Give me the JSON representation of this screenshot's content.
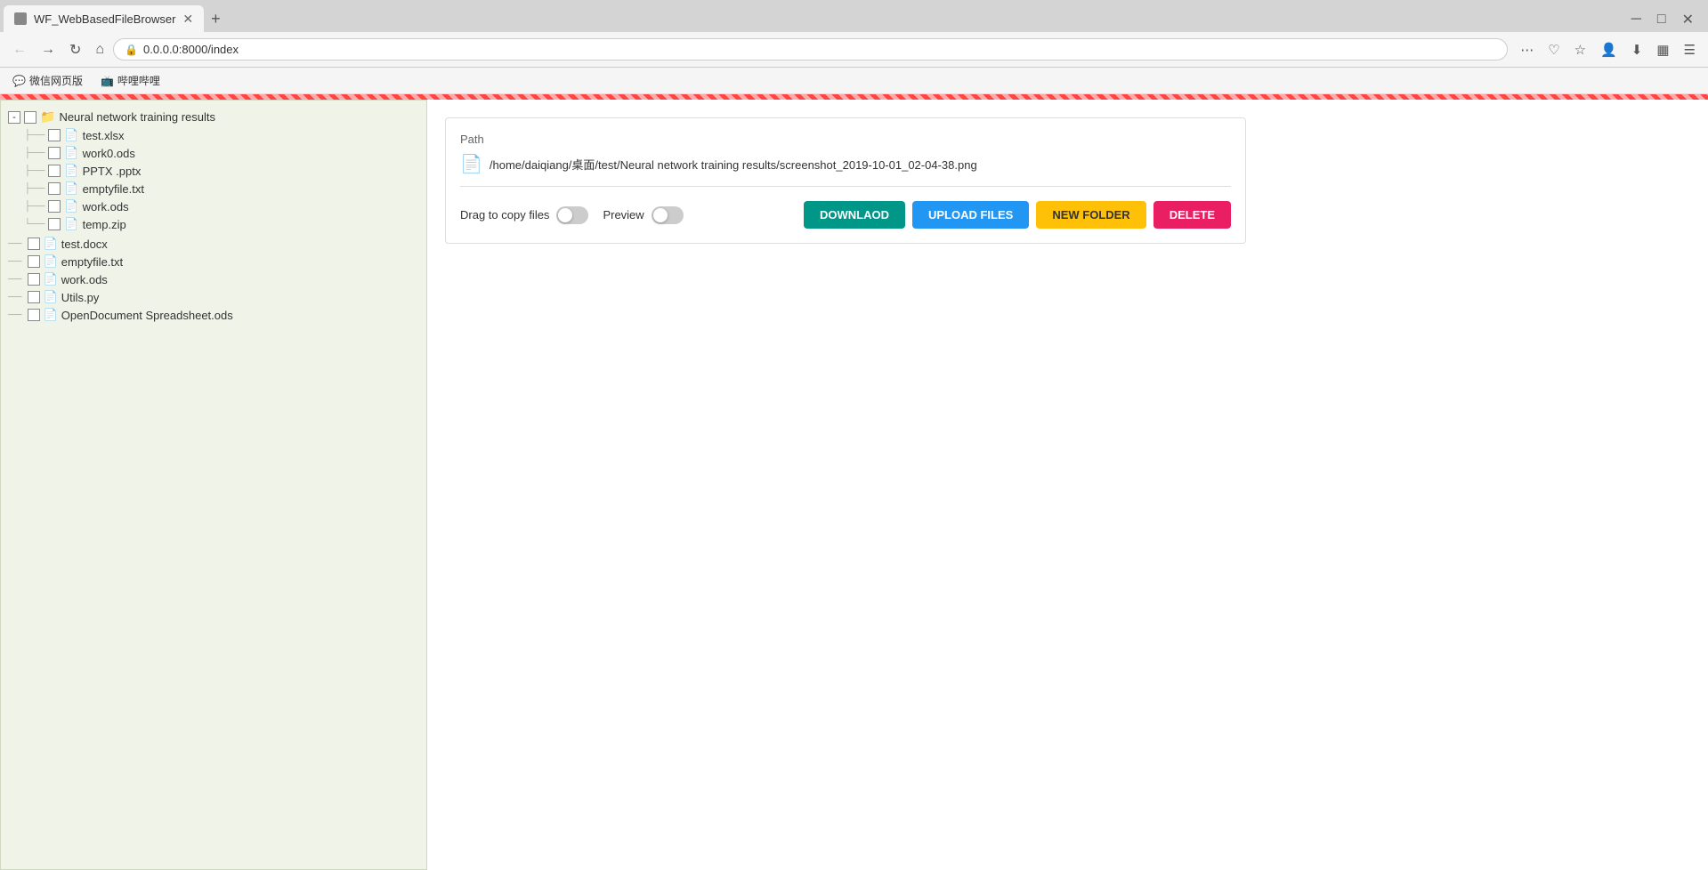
{
  "browser": {
    "tab_title": "WF_WebBasedFileBrowser",
    "address": "0.0.0.0:8000/index",
    "bookmarks": [
      {
        "id": "wechat",
        "label": "微信网页版",
        "icon": "💬"
      },
      {
        "id": "bilibili",
        "label": "哔哩哔哩",
        "icon": "📺"
      }
    ]
  },
  "file_tree": {
    "root": {
      "name": "Neural network training results",
      "children": [
        {
          "name": "test.xlsx",
          "type": "file",
          "indent": 1
        },
        {
          "name": "work0.ods",
          "type": "file",
          "indent": 1
        },
        {
          "name": "PPTX .pptx",
          "type": "file",
          "indent": 1
        },
        {
          "name": "emptyfile.txt",
          "type": "file",
          "indent": 1
        },
        {
          "name": "work.ods",
          "type": "file",
          "indent": 1
        },
        {
          "name": "temp.zip",
          "type": "file",
          "indent": 1
        }
      ]
    },
    "other_items": [
      {
        "name": "test.docx",
        "type": "file",
        "indent": 0
      },
      {
        "name": "emptyfile.txt",
        "type": "file",
        "indent": 0
      },
      {
        "name": "work.ods",
        "type": "file",
        "indent": 0
      },
      {
        "name": "Utils.py",
        "type": "file",
        "indent": 0
      },
      {
        "name": "OpenDocument Spreadsheet.ods",
        "type": "file",
        "indent": 0
      }
    ]
  },
  "right_panel": {
    "path_label": "Path",
    "path_value": "/home/daiqiang/桌面/test/Neural network training results/screenshot_2019-10-01_02-04-38.png",
    "drag_to_copy_label": "Drag to copy files",
    "preview_label": "Preview",
    "drag_active": false,
    "preview_active": false,
    "buttons": {
      "download": "DOWNLAOD",
      "upload": "UPLOAD FILES",
      "new_folder": "NEW FOLDER",
      "delete": "DELETE"
    }
  }
}
